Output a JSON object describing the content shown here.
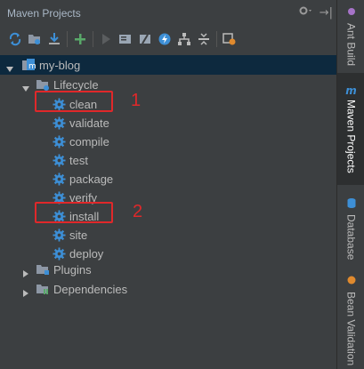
{
  "panel": {
    "title": "Maven Projects",
    "title_tools": {
      "gear_icon": "gear-icon",
      "hide_label": "→|"
    }
  },
  "toolbar": {
    "buttons": [
      "refresh-icon",
      "reimport-icon",
      "download-icon",
      "add-icon",
      "run-icon",
      "execute-goal-icon",
      "toggle-offline-icon",
      "skip-tests-icon",
      "show-dependencies-icon",
      "collapse-all-icon",
      "settings-icon"
    ]
  },
  "tree": {
    "root": {
      "label": "my-blog"
    },
    "lifecycle": {
      "label": "Lifecycle",
      "goals": [
        "clean",
        "validate",
        "compile",
        "test",
        "package",
        "verify",
        "install",
        "site",
        "deploy"
      ]
    },
    "plugins": {
      "label": "Plugins"
    },
    "dependencies": {
      "label": "Dependencies"
    }
  },
  "side_tabs": [
    {
      "label": "Ant Build",
      "active": false
    },
    {
      "label": "Maven Projects",
      "active": true
    },
    {
      "label": "Database",
      "active": false
    },
    {
      "label": "Bean Validation",
      "active": false
    }
  ],
  "annotations": [
    {
      "number": "1",
      "target": "clean"
    },
    {
      "number": "2",
      "target": "install"
    }
  ],
  "colors": {
    "background": "#3c3f41",
    "selection": "#0d293e",
    "gear": "#3d8fd6",
    "annotation": "#e0282a"
  }
}
